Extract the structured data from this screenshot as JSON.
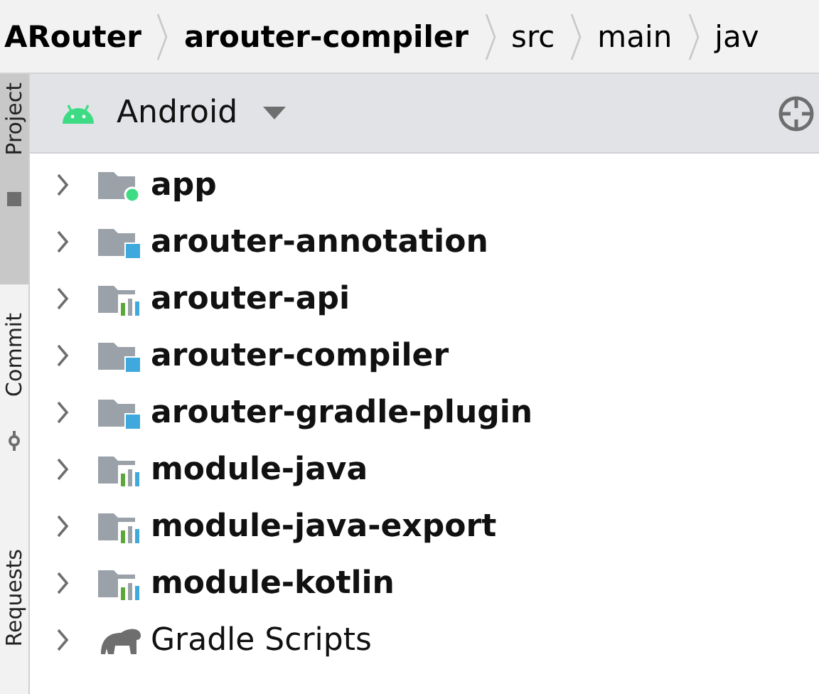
{
  "breadcrumb": [
    {
      "label": "ARouter",
      "bold": true
    },
    {
      "label": "arouter-compiler",
      "bold": true
    },
    {
      "label": "src",
      "bold": false
    },
    {
      "label": "main",
      "bold": false
    },
    {
      "label": "jav",
      "bold": false
    }
  ],
  "side_tabs": [
    {
      "label": "Project",
      "selected": true
    },
    {
      "label": "Commit",
      "selected": false
    },
    {
      "label": "Requests",
      "selected": false
    }
  ],
  "toolbar": {
    "view": "Android"
  },
  "tree": [
    {
      "label": "app",
      "kind": "app",
      "expanded": false
    },
    {
      "label": "arouter-annotation",
      "kind": "library",
      "expanded": false
    },
    {
      "label": "arouter-api",
      "kind": "module",
      "expanded": false
    },
    {
      "label": "arouter-compiler",
      "kind": "library",
      "expanded": false
    },
    {
      "label": "arouter-gradle-plugin",
      "kind": "library",
      "expanded": false
    },
    {
      "label": "module-java",
      "kind": "module",
      "expanded": false
    },
    {
      "label": "module-java-export",
      "kind": "module",
      "expanded": false
    },
    {
      "label": "module-kotlin",
      "kind": "module",
      "expanded": false
    },
    {
      "label": "Gradle Scripts",
      "kind": "gradle",
      "expanded": false
    }
  ]
}
